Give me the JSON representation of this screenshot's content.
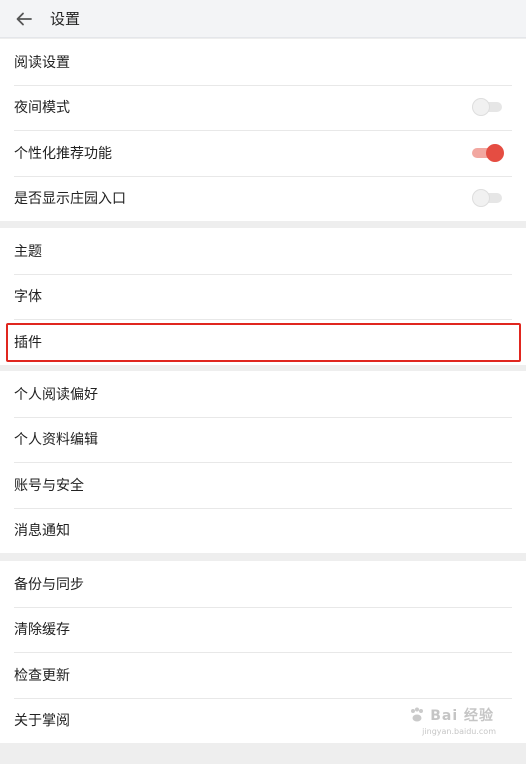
{
  "header": {
    "title": "设置"
  },
  "groups": [
    {
      "items": [
        {
          "label": "阅读设置"
        },
        {
          "label": "夜间模式",
          "toggle": false
        },
        {
          "label": "个性化推荐功能",
          "toggle": true
        },
        {
          "label": "是否显示庄园入口",
          "toggle": false
        }
      ]
    },
    {
      "items": [
        {
          "label": "主题"
        },
        {
          "label": "字体"
        },
        {
          "label": "插件",
          "highlighted": true
        }
      ]
    },
    {
      "items": [
        {
          "label": "个人阅读偏好"
        },
        {
          "label": "个人资料编辑"
        },
        {
          "label": "账号与安全"
        },
        {
          "label": "消息通知"
        }
      ]
    },
    {
      "items": [
        {
          "label": "备份与同步"
        },
        {
          "label": "清除缓存"
        },
        {
          "label": "检查更新"
        },
        {
          "label": "关于掌阅"
        }
      ]
    }
  ],
  "colors": {
    "accent": "#e54d42",
    "highlight_border": "#e0261f"
  },
  "watermark": {
    "text": "Bai 经验",
    "sub": "jingyan.baidu.com"
  }
}
